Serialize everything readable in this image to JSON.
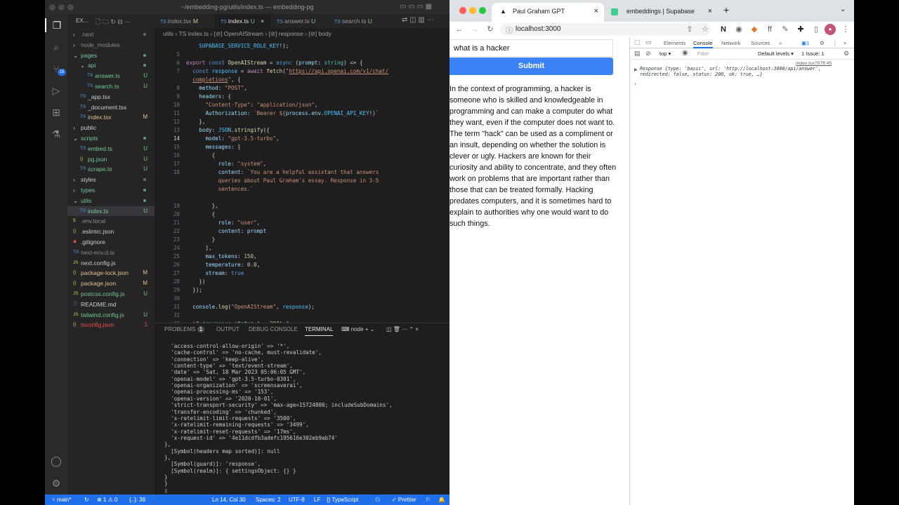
{
  "vscode": {
    "title": "~/embedding-pg/utils/index.ts — embedding-pg",
    "explorer_header": "EX...",
    "tree": [
      {
        "name": ".next",
        "status": "",
        "depth": 0,
        "type": "folder",
        "color": "#8a8a8a",
        "dot": true
      },
      {
        "name": "node_modules",
        "status": "",
        "depth": 0,
        "type": "folder",
        "color": "#8a8a8a",
        "dot": false
      },
      {
        "name": "pages",
        "status": "",
        "depth": 0,
        "type": "folder-open",
        "color": "#73c991",
        "dot": true
      },
      {
        "name": "api",
        "status": "",
        "depth": 1,
        "type": "folder-open",
        "color": "#73c991",
        "dot": true
      },
      {
        "name": "answer.ts",
        "status": "U",
        "depth": 2,
        "type": "ts",
        "color": "#73c991",
        "dot": false
      },
      {
        "name": "search.ts",
        "status": "U",
        "depth": 2,
        "type": "ts",
        "color": "#73c991",
        "dot": false
      },
      {
        "name": "_app.tsx",
        "status": "",
        "depth": 1,
        "type": "ts",
        "color": "#cccccc",
        "dot": false
      },
      {
        "name": "_document.tsx",
        "status": "",
        "depth": 1,
        "type": "ts",
        "color": "#cccccc",
        "dot": false
      },
      {
        "name": "index.tsx",
        "status": "M",
        "depth": 1,
        "type": "ts",
        "color": "#e2c08d",
        "dot": false
      },
      {
        "name": "public",
        "status": "",
        "depth": 0,
        "type": "folder",
        "color": "#cccccc",
        "dot": false
      },
      {
        "name": "scripts",
        "status": "",
        "depth": 0,
        "type": "folder-open",
        "color": "#73c991",
        "dot": true
      },
      {
        "name": "embed.ts",
        "status": "U",
        "depth": 1,
        "type": "ts",
        "color": "#73c991",
        "dot": false
      },
      {
        "name": "pg.json",
        "status": "U",
        "depth": 1,
        "type": "json",
        "color": "#73c991",
        "dot": false
      },
      {
        "name": "scrape.ts",
        "status": "U",
        "depth": 1,
        "type": "ts",
        "color": "#73c991",
        "dot": false
      },
      {
        "name": "styles",
        "status": "",
        "depth": 0,
        "type": "folder",
        "color": "#cccccc",
        "dot": true
      },
      {
        "name": "types",
        "status": "",
        "depth": 0,
        "type": "folder",
        "color": "#73c991",
        "dot": true
      },
      {
        "name": "utils",
        "status": "",
        "depth": 0,
        "type": "folder-open",
        "color": "#73c991",
        "dot": true
      },
      {
        "name": "index.ts",
        "status": "U",
        "depth": 1,
        "type": "ts",
        "color": "#73c991",
        "dot": false,
        "selected": true
      },
      {
        "name": ".env.local",
        "status": "",
        "depth": 0,
        "type": "env",
        "color": "#8a8a8a",
        "dot": false
      },
      {
        "name": ".eslintrc.json",
        "status": "",
        "depth": 0,
        "type": "json",
        "color": "#cccccc",
        "dot": false
      },
      {
        "name": ".gitignore",
        "status": "",
        "depth": 0,
        "type": "git",
        "color": "#cccccc",
        "dot": false
      },
      {
        "name": "next-env.d.ts",
        "status": "",
        "depth": 0,
        "type": "ts",
        "color": "#8a8a8a",
        "dot": false
      },
      {
        "name": "next.config.js",
        "status": "",
        "depth": 0,
        "type": "js",
        "color": "#cccccc",
        "dot": false
      },
      {
        "name": "package-lock.json",
        "status": "M",
        "depth": 0,
        "type": "json",
        "color": "#e2c08d",
        "dot": false
      },
      {
        "name": "package.json",
        "status": "M",
        "depth": 0,
        "type": "json",
        "color": "#e2c08d",
        "dot": false
      },
      {
        "name": "postcss.config.js",
        "status": "U",
        "depth": 0,
        "type": "js",
        "color": "#73c991",
        "dot": false
      },
      {
        "name": "README.md",
        "status": "",
        "depth": 0,
        "type": "md",
        "color": "#cccccc",
        "dot": false
      },
      {
        "name": "tailwind.config.js",
        "status": "U",
        "depth": 0,
        "type": "js",
        "color": "#73c991",
        "dot": false
      },
      {
        "name": "tsconfig.json",
        "status": "1",
        "depth": 0,
        "type": "json",
        "color": "#f14c4c",
        "dot": false
      }
    ],
    "tabs": [
      {
        "label": "index.tsx",
        "status": "M",
        "active": false
      },
      {
        "label": "index.ts",
        "status": "U",
        "active": true
      },
      {
        "label": "answer.ts",
        "status": "U",
        "active": false
      },
      {
        "label": "search.ts",
        "status": "U",
        "active": false
      }
    ],
    "breadcrumb": "utils  ›  TS index.ts  ›  [⊘] OpenAIStream  ›  [⊘] response  ›  [⊘] body",
    "code": [
      {
        "n": "",
        "html": "    <span class='v'>SUPABASE_SERVICE_ROLE_KEY</span>!);"
      },
      {
        "n": "5",
        "html": ""
      },
      {
        "n": "6",
        "html": "<span class='c'>export</span> <span class='k'>const</span> <span class='f'>OpenAIStream</span> = <span class='k'>async</span> (<span class='p'>prompt</span>: <span class='t'>string</span>) => {"
      },
      {
        "n": "7",
        "html": "  <span class='k'>const</span> <span class='v'>response</span> = <span class='c'>await</span> <span class='f'>fetch</span>(<span class='s'>\"<u>https://api.openai.com/v1/chat/</u></span>"
      },
      {
        "n": "",
        "html": "  <span class='s'><u>completions</u>\"</span>, {"
      },
      {
        "n": "8",
        "html": "    <span class='p'>method</span>: <span class='s'>\"POST\"</span>,"
      },
      {
        "n": "9",
        "html": "    <span class='p'>headers</span>: {"
      },
      {
        "n": "10",
        "html": "      <span class='s'>\"Content-Type\"</span>: <span class='s'>\"application/json\"</span>,"
      },
      {
        "n": "11",
        "html": "      <span class='p'>Authorization</span>: <span class='s'>`Bearer ${</span><span class='p'>process</span>.<span class='p'>env</span>.<span class='v'>OPENAI_API_KEY</span>!<span class='s'>}`</span>"
      },
      {
        "n": "12",
        "html": "    },"
      },
      {
        "n": "13",
        "html": "    <span class='p'>body</span>: <span class='v'>JSON</span>.<span class='f'>stringify</span>({"
      },
      {
        "n": "14",
        "html": "      <span class='p'>model</span>: <span class='s'>\"gpt-3.5-turbo\"</span>,",
        "cur": true
      },
      {
        "n": "15",
        "html": "      <span class='p'>messages</span>: ["
      },
      {
        "n": "16",
        "html": "        {"
      },
      {
        "n": "17",
        "html": "          <span class='p'>role</span>: <span class='s'>\"system\"</span>,"
      },
      {
        "n": "18",
        "html": "          <span class='p'>content</span>: <span class='s'>`You are a helpful assistant that answers</span>"
      },
      {
        "n": "",
        "html": "          <span class='s'>queries about Paul Graham's essay. Response in 3-5</span>"
      },
      {
        "n": "",
        "html": "          <span class='s'>sentences.`</span>"
      },
      {
        "n": "",
        "html": ""
      },
      {
        "n": "19",
        "html": "        },"
      },
      {
        "n": "20",
        "html": "        {"
      },
      {
        "n": "21",
        "html": "          <span class='p'>role</span>: <span class='s'>\"user\"</span>,"
      },
      {
        "n": "22",
        "html": "          <span class='p'>content</span>: <span class='p'>prompt</span>"
      },
      {
        "n": "23",
        "html": "        }"
      },
      {
        "n": "24",
        "html": "      ],"
      },
      {
        "n": "25",
        "html": "      <span class='p'>max_tokens</span>: <span class='n'>150</span>,"
      },
      {
        "n": "26",
        "html": "      <span class='p'>temperature</span>: <span class='n'>0.0</span>,"
      },
      {
        "n": "27",
        "html": "      <span class='p'>stream</span>: <span class='k'>true</span>"
      },
      {
        "n": "28",
        "html": "    })"
      },
      {
        "n": "29",
        "html": "  });"
      },
      {
        "n": "30",
        "html": ""
      },
      {
        "n": "31",
        "html": "  <span class='p'>console</span>.<span class='f'>log</span>(<span class='s'>\"OpenAIStream\"</span>, <span class='v'>response</span>);"
      },
      {
        "n": "32",
        "html": ""
      },
      {
        "n": "33",
        "html": "  <span class='c'>if</span> (<span class='v'>response</span>.<span class='p'>status</span> !== <span class='n'>200</span>) {"
      }
    ],
    "panel_tabs": [
      "PROBLEMS",
      "OUTPUT",
      "DEBUG CONSOLE",
      "TERMINAL"
    ],
    "problems_count": "1",
    "terminal_shell": "node",
    "terminal": [
      "  'access-control-allow-origin' => '*',",
      "  'cache-control' => 'no-cache, must-revalidate',",
      "  'connection' => 'keep-alive',",
      "  'content-type' => 'text/event-stream',",
      "  'date' => 'Sat, 18 Mar 2023 05:06:05 GMT',",
      "  'openai-model' => 'gpt-3.5-turbo-0301',",
      "  'openai-organization' => 'screensaverai',",
      "  'openai-processing-ms' => '153',",
      "  'openai-version' => '2020-10-01',",
      "  'strict-transport-security' => 'max-age=15724800; includeSubDomains',",
      "  'transfer-encoding' => 'chunked',",
      "  'x-ratelimit-limit-requests' => '3500',",
      "  'x-ratelimit-remaining-requests' => '3499',",
      "  'x-ratelimit-reset-requests' => '17ms',",
      "  'x-request-id' => '4e11dcdfb3adefc195616e302eb9ab74'",
      "},",
      "  [Symbol(headers map sorted)]: null",
      "},",
      "  [Symbol(guard)]: 'response',",
      "  [Symbol(realm)]: { settingsObject: {} }",
      "}",
      "}",
      "▯"
    ],
    "status": {
      "branch": "main*",
      "errors": "⊗ 1 ⚠ 0",
      "braces": "{..}: 39",
      "position": "Ln 14, Col 30",
      "spaces": "Spaces: 2",
      "encoding": "UTF-8",
      "eol": "LF",
      "language": "TypeScript",
      "prettier": "✓ Prettier"
    }
  },
  "browser": {
    "tabs": [
      {
        "label": "Paul Graham GPT",
        "active": true
      },
      {
        "label": "embeddings | Supabase",
        "active": false
      }
    ],
    "url": "localhost:3000",
    "input_value": "what is a hacker",
    "submit_label": "Submit",
    "answer": "In the context of programming, a hacker is someone who is skilled and knowledgeable in programming and can make a computer do what they want, even if the computer does not want to. The term \"hack\" can be used as a compliment or an insult, depending on whether the solution is clever or ugly. Hackers are known for their curiosity and ability to concentrate, and they often work on problems that are important rather than those that can be treated formally. Hacking predates computers, and it is sometimes hard to explain to authorities why one would want to do such things.",
    "devtools": {
      "tabs": [
        "Elements",
        "Console",
        "Network",
        "Sources"
      ],
      "active_tab": "Console",
      "context": "top",
      "filter_placeholder": "Filter",
      "levels": "Default levels",
      "issues": "1 Issue: 1",
      "log_source": "index.tsx?07ff:45",
      "log_text": "Response {type: 'basic', url: 'http://localhost:3000/api/answer', redirected: false, status: 200, ok: true, …}"
    }
  }
}
